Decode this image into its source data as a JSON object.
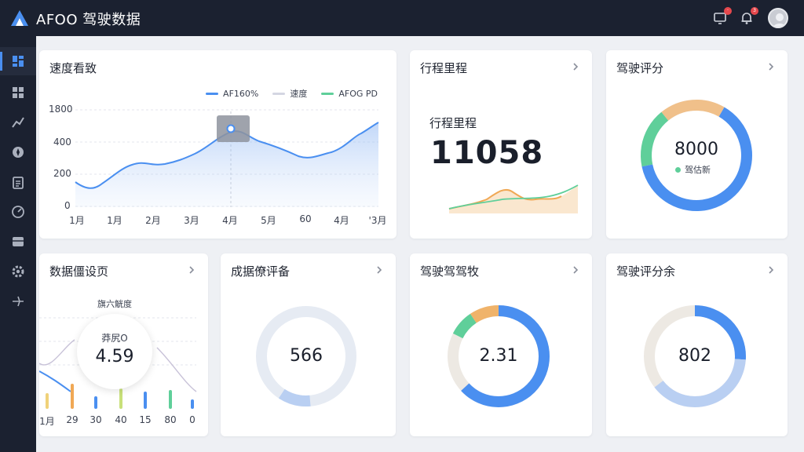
{
  "header": {
    "title": "AFOO 驾驶数据",
    "notify_badge": "·",
    "alert_badge": "3"
  },
  "sidebar": {
    "items": [
      {
        "icon": "dashboard-icon"
      },
      {
        "icon": "grid-icon"
      },
      {
        "icon": "chart-icon"
      },
      {
        "icon": "compass-icon"
      },
      {
        "icon": "clipboard-icon"
      },
      {
        "icon": "gauge-icon"
      },
      {
        "icon": "box-icon"
      },
      {
        "icon": "settings-icon"
      },
      {
        "icon": "plane-icon"
      }
    ]
  },
  "speed_card": {
    "title": "速度看致",
    "legend": [
      "AF160%",
      "速度",
      "AFOG PD"
    ],
    "yticks": [
      "1800",
      "400",
      "200",
      "0"
    ],
    "xticks": [
      "1月",
      "1月",
      "2月",
      "3月",
      "4月",
      "5月",
      "60",
      "4月",
      "'3月"
    ]
  },
  "trip_card": {
    "title": "行程里程",
    "label": "行程里程",
    "value": "11058"
  },
  "score_card": {
    "title": "驾驶评分",
    "value": "8000",
    "sub": "驾估新"
  },
  "data_card": {
    "title": "数据僵设页",
    "subtitle": "旗六觥度",
    "bubble_label": "莽尻O",
    "bubble_value": "4.59",
    "xticks": [
      "1月",
      "29",
      "30",
      "40",
      "15",
      "80",
      "0"
    ]
  },
  "eval_card": {
    "title": "成据僚评备",
    "value": "566"
  },
  "drive_card": {
    "title": "驾驶驾驾牧",
    "value": "2.31"
  },
  "score2_card": {
    "title": "驾驶评分余",
    "value": "802"
  },
  "colors": {
    "accent": "#4a8ff0",
    "orange": "#f0b36a",
    "green": "#5fcf9a",
    "sidebar_bg": "#1b2130"
  },
  "chart_data": [
    {
      "type": "area",
      "title": "速度看致",
      "categories": [
        "1月",
        "1月",
        "2月",
        "3月",
        "4月",
        "5月",
        "60",
        "4月",
        "'3月"
      ],
      "series": [
        {
          "name": "AF160%",
          "values": [
            120,
            160,
            260,
            300,
            450,
            360,
            280,
            310,
            520
          ]
        }
      ],
      "yticks": [
        "1800",
        "400",
        "200",
        "0"
      ]
    }
  ]
}
